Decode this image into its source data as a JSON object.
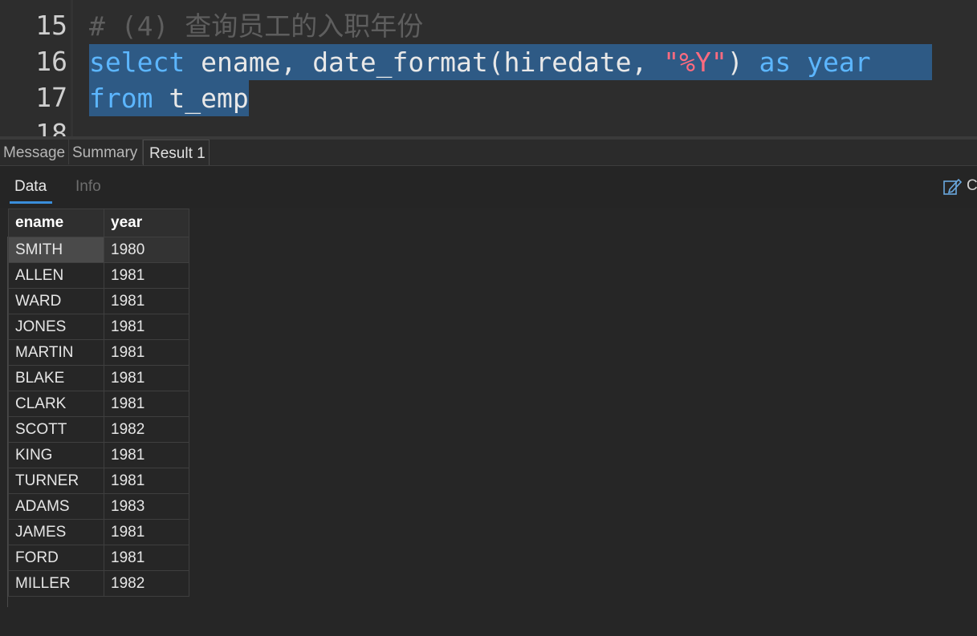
{
  "editor": {
    "line_numbers": [
      "15",
      "16",
      "17",
      "18"
    ],
    "line15": {
      "hash": "#",
      "paren": "(4)",
      "comment": "查询员工的入职年份"
    },
    "line16": {
      "kw_select": "select",
      "ename": "ename,",
      "func": "date_format(hiredate,",
      "str": "\"%Y\"",
      "close": ")",
      "kw_as": "as",
      "kw_year": "year"
    },
    "line17": {
      "kw_from": "from",
      "table": "t_emp"
    }
  },
  "result_tabs": [
    "Message",
    "Summary",
    "Result 1"
  ],
  "sub_tabs": {
    "data": "Data",
    "info": "Info"
  },
  "toolbar": {
    "copy_label": "Co"
  },
  "grid": {
    "columns": [
      "ename",
      "year"
    ],
    "rows": [
      [
        "SMITH",
        "1980"
      ],
      [
        "ALLEN",
        "1981"
      ],
      [
        "WARD",
        "1981"
      ],
      [
        "JONES",
        "1981"
      ],
      [
        "MARTIN",
        "1981"
      ],
      [
        "BLAKE",
        "1981"
      ],
      [
        "CLARK",
        "1981"
      ],
      [
        "SCOTT",
        "1982"
      ],
      [
        "KING",
        "1981"
      ],
      [
        "TURNER",
        "1981"
      ],
      [
        "ADAMS",
        "1983"
      ],
      [
        "JAMES",
        "1981"
      ],
      [
        "FORD",
        "1981"
      ],
      [
        "MILLER",
        "1982"
      ]
    ]
  },
  "colors": {
    "keyword": "#5cb6ff",
    "string": "#ff6b7f",
    "selection": "#2e5a85",
    "accent": "#3a8edb"
  }
}
